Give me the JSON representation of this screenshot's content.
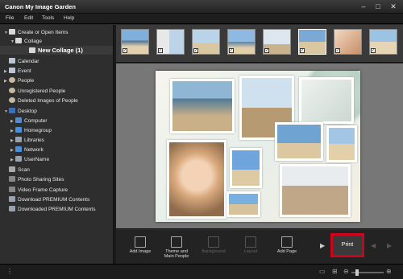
{
  "window": {
    "title": "Canon My Image Garden",
    "min": "–",
    "max": "□",
    "close": "✕"
  },
  "menu": [
    "File",
    "Edit",
    "Tools",
    "Help"
  ],
  "sidebar": {
    "items": [
      {
        "label": "Create or Open Items",
        "icon": "create-items-icon"
      },
      {
        "label": "Collage",
        "icon": "collage-icon"
      },
      {
        "label": "New Collage (1)",
        "icon": "collage-item-icon"
      },
      {
        "label": "Calendar",
        "icon": "calendar-icon"
      },
      {
        "label": "Event",
        "icon": "event-icon"
      },
      {
        "label": "People",
        "icon": "people-icon"
      },
      {
        "label": "Unregistered People",
        "icon": "unregistered-people-icon"
      },
      {
        "label": "Deleted Images of People",
        "icon": "deleted-people-icon"
      },
      {
        "label": "Desktop",
        "icon": "desktop-icon"
      },
      {
        "label": "Computer",
        "icon": "computer-icon"
      },
      {
        "label": "Homegroup",
        "icon": "homegroup-icon"
      },
      {
        "label": "Libraries",
        "icon": "libraries-icon"
      },
      {
        "label": "Network",
        "icon": "network-icon"
      },
      {
        "label": "UserName",
        "icon": "user-folder-icon"
      },
      {
        "label": "Scan",
        "icon": "scan-icon"
      },
      {
        "label": "Photo Sharing Sites",
        "icon": "photo-sharing-icon"
      },
      {
        "label": "Video Frame Capture",
        "icon": "video-frame-icon"
      },
      {
        "label": "Download PREMIUM Contents",
        "icon": "download-premium-icon"
      },
      {
        "label": "Downloaded PREMIUM Contents",
        "icon": "downloaded-premium-icon"
      }
    ]
  },
  "toolbar": {
    "add_image": "Add Image",
    "theme_line1": "Theme and",
    "theme_line2": "Main People",
    "background": "Background",
    "layout": "Layout",
    "add_page": "Add Page",
    "print": "Print"
  },
  "colors": {
    "print_highlight": "#d0021b",
    "sky": "#7fb0dc",
    "sand": "#e3d2b0"
  }
}
